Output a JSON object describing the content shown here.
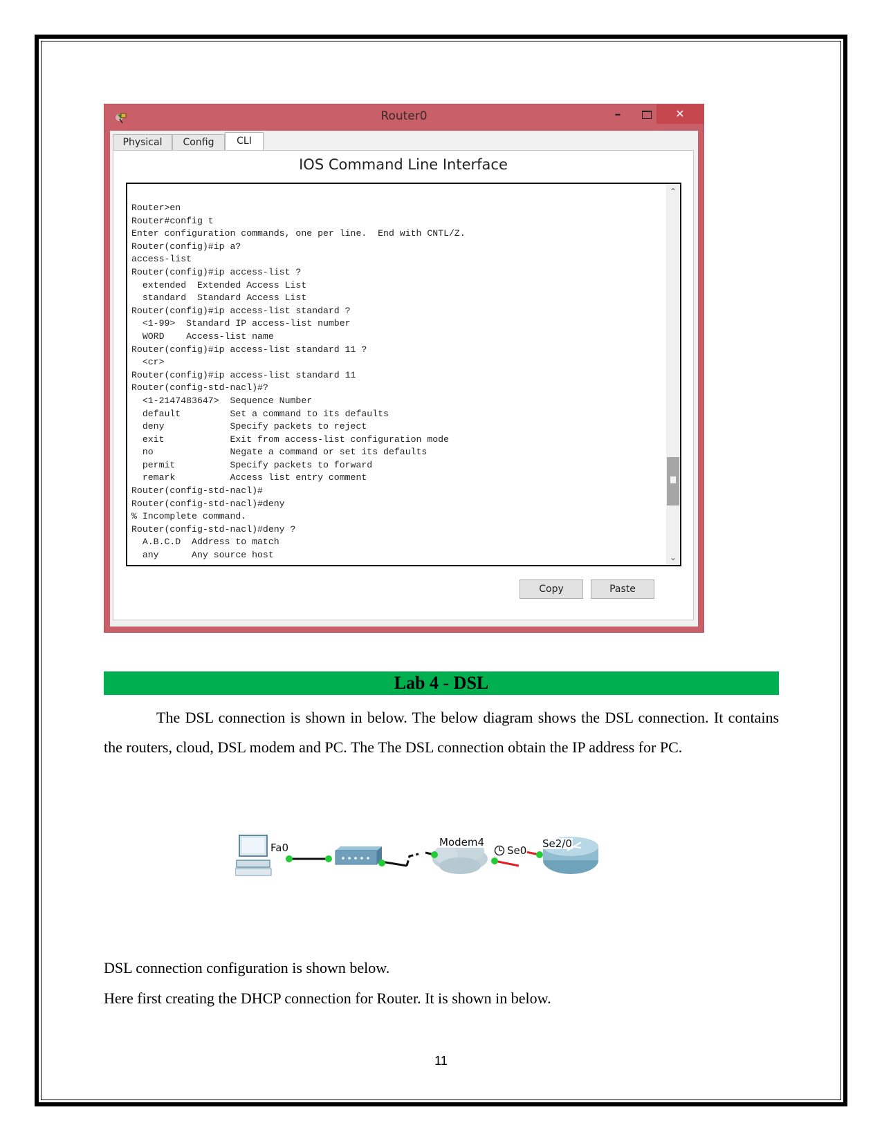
{
  "window": {
    "title": "Router0",
    "icon": "packet-tracer-device-icon",
    "controls": {
      "minimize": "–",
      "maximize": "maximize-icon",
      "close": "✕"
    },
    "tabs": [
      {
        "label": "Physical",
        "active": false
      },
      {
        "label": "Config",
        "active": false
      },
      {
        "label": "CLI",
        "active": true
      }
    ],
    "panel_heading": "IOS Command Line Interface",
    "terminal_lines": [
      "Router>en",
      "Router#config t",
      "Enter configuration commands, one per line.  End with CNTL/Z.",
      "Router(config)#ip a?",
      "access-list",
      "Router(config)#ip access-list ?",
      "  extended  Extended Access List",
      "  standard  Standard Access List",
      "Router(config)#ip access-list standard ?",
      "  <1-99>  Standard IP access-list number",
      "  WORD    Access-list name",
      "Router(config)#ip access-list standard 11 ?",
      "  <cr>",
      "Router(config)#ip access-list standard 11",
      "Router(config-std-nacl)#?",
      "  <1-2147483647>  Sequence Number",
      "  default         Set a command to its defaults",
      "  deny            Specify packets to reject",
      "  exit            Exit from access-list configuration mode",
      "  no              Negate a command or set its defaults",
      "  permit          Specify packets to forward",
      "  remark          Access list entry comment",
      "Router(config-std-nacl)#",
      "Router(config-std-nacl)#deny",
      "% Incomplete command.",
      "Router(config-std-nacl)#deny ?",
      "  A.B.C.D  Address to match",
      "  any      Any source host"
    ],
    "scroll_position_fraction": 0.85,
    "buttons": {
      "copy": "Copy",
      "paste": "Paste"
    }
  },
  "document": {
    "section_title": "Lab 4 - DSL",
    "section_color": "#00b050",
    "intro_paragraph": "The DSL connection is shown in below. The below diagram shows the DSL connection. It contains the routers, cloud, DSL modem and PC. The The DSL connection obtain the IP address for PC.",
    "diagram": {
      "devices": [
        "PC",
        "DSL Modem",
        "Cloud",
        "Router"
      ],
      "labels": {
        "pc_port": "Fa0",
        "cloud": "Modem4",
        "cloud_serial": "Se0",
        "router_serial": "Se2/0"
      },
      "link_colors": {
        "up": "#22cc33",
        "serial": "#e02020",
        "copper": "#111111"
      }
    },
    "line1": "DSL connection configuration is shown below.",
    "line2": "Here first creating the DHCP connection for Router. It is shown in below.",
    "page_number": "11"
  }
}
